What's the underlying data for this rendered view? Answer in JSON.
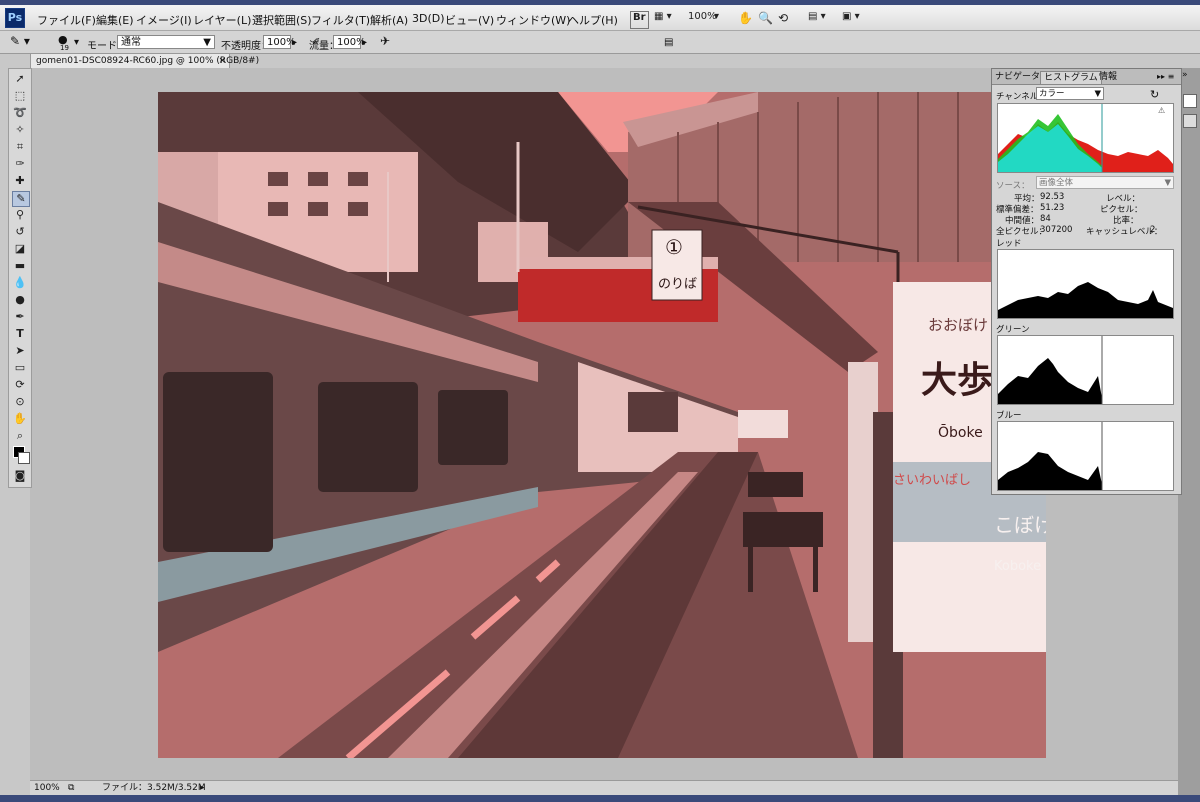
{
  "app": {
    "logo": "Ps"
  },
  "menu": [
    "ファイル(F)",
    "編集(E)",
    "イメージ(I)",
    "レイヤー(L)",
    "選択範囲(S)",
    "フィルタ(T)",
    "解析(A)",
    "3D(D)",
    "ビュー(V)",
    "ウィンドウ(W)",
    "ヘルプ(H)"
  ],
  "menubar_tools": {
    "zoom": "100%",
    "br": "Br"
  },
  "options": {
    "brush_size": "19",
    "mode_label": "モード：",
    "mode_value": "通常",
    "opacity_label": "不透明度：",
    "opacity_value": "100%",
    "flow_label": "流量：",
    "flow_value": "100%"
  },
  "document": {
    "tab_title": "gomen01-DSC08924-RC60.jpg @ 100% (RGB/8#)"
  },
  "status": {
    "zoom": "100%",
    "file_info": "ファイル：3.52M/3.52M"
  },
  "histogram_panel": {
    "tabs": [
      "ナビゲータ",
      "ヒストグラム",
      "情報"
    ],
    "channel_label": "チャンネル：",
    "channel_value": "カラー",
    "source_label": "ソース：",
    "source_value": "画像全体",
    "stats": {
      "mean_label": "平均：",
      "mean": "92.53",
      "stddev_label": "標準偏差：",
      "stddev": "51.23",
      "median_label": "中間値：",
      "median": "84",
      "pixels_label": "全ピクセル：",
      "pixels": "307200",
      "level_label": "レベル：",
      "count_label": "ピクセル：",
      "percentile_label": "比率：",
      "cache_label": "キャッシュレベル：",
      "cache": "2"
    },
    "channels": [
      "レッド",
      "グリーン",
      "ブルー"
    ]
  },
  "photo_signs": {
    "platform_number": "①",
    "platform_word": "のりば",
    "station_hiragana": "おおぼけ",
    "station_kanji": "大歩危",
    "station_romaji": "Ōboke",
    "next_station_kana": "こぼけ",
    "next_station_romaji": "Koboke",
    "prev_station_kana": "さいわいばし"
  },
  "colors": {
    "photo_tint": "#b56d6c",
    "platform": "#7a4a4a",
    "hist_red": "#e0201a",
    "hist_green": "#20c020",
    "hist_cyan": "#20e0e0"
  }
}
